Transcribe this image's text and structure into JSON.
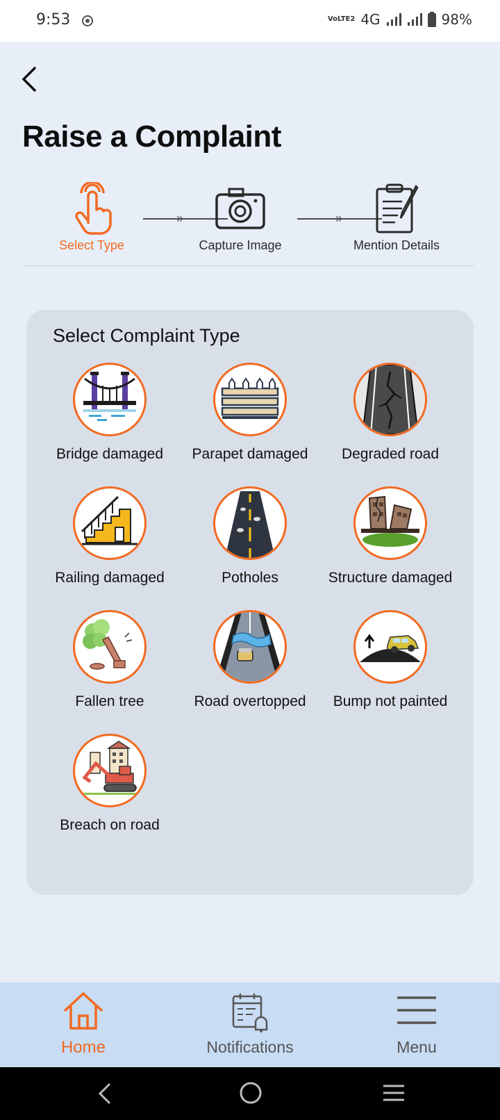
{
  "status_bar": {
    "time": "9:53",
    "network": "4G",
    "volte": "VoLTE2",
    "battery": "98%"
  },
  "header": {
    "title": "Raise a Complaint"
  },
  "stepper": {
    "steps": [
      {
        "label": "Select Type",
        "icon": "tap-hand-icon",
        "active": true
      },
      {
        "label": "Capture Image",
        "icon": "camera-icon",
        "active": false
      },
      {
        "label": "Mention Details",
        "icon": "clipboard-pen-icon",
        "active": false
      }
    ]
  },
  "complaint_panel": {
    "title": "Select Complaint Type",
    "types": [
      {
        "label": "Bridge damaged",
        "icon": "bridge-icon"
      },
      {
        "label": "Parapet damaged",
        "icon": "parapet-icon"
      },
      {
        "label": "Degraded road",
        "icon": "cracked-road-icon"
      },
      {
        "label": "Railing damaged",
        "icon": "staircase-railing-icon"
      },
      {
        "label": "Potholes",
        "icon": "pothole-road-icon"
      },
      {
        "label": "Structure damaged",
        "icon": "collapsed-building-icon"
      },
      {
        "label": "Fallen tree",
        "icon": "fallen-tree-icon"
      },
      {
        "label": "Road overtopped",
        "icon": "flooded-road-icon"
      },
      {
        "label": "Bump not painted",
        "icon": "speed-bump-icon"
      },
      {
        "label": "Breach on road",
        "icon": "excavator-icon"
      }
    ]
  },
  "bottom_nav": {
    "items": [
      {
        "label": "Home",
        "icon": "home-icon",
        "active": true
      },
      {
        "label": "Notifications",
        "icon": "calendar-bell-icon",
        "active": false
      },
      {
        "label": "Menu",
        "icon": "hamburger-menu-icon",
        "active": false
      }
    ]
  },
  "colors": {
    "accent": "#f26a21",
    "background": "#e7eef8",
    "panel": "#d9dfe9",
    "nav": "#c8dcf4"
  }
}
